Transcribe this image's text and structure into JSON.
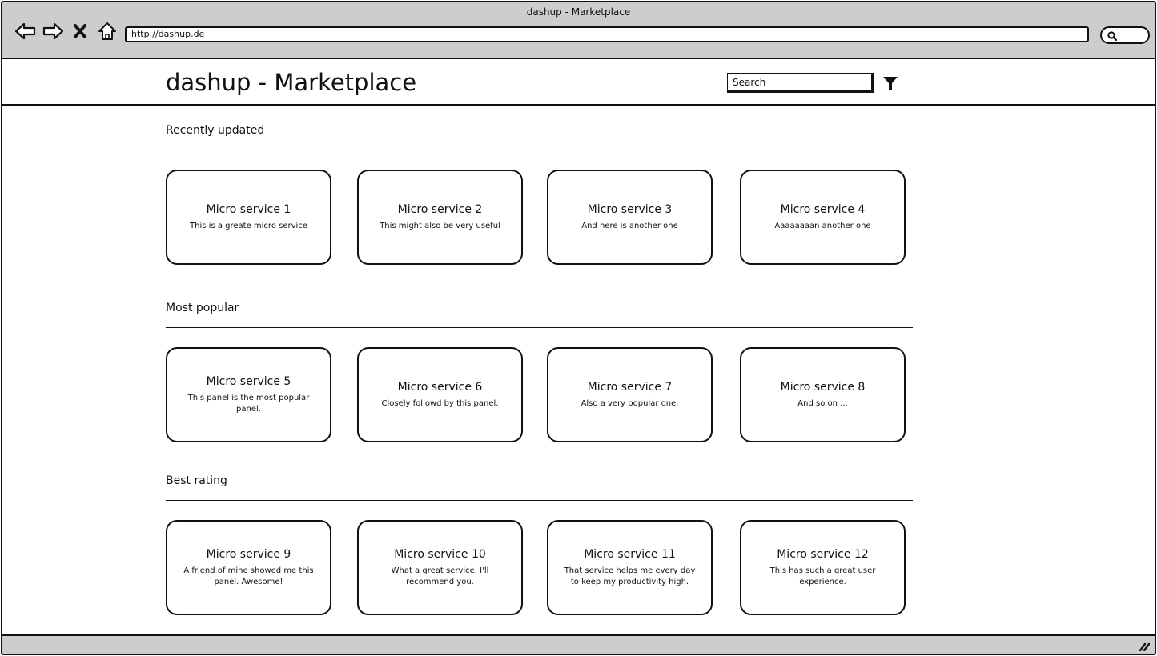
{
  "window": {
    "title": "dashup - Marketplace",
    "url": "http://dashup.de"
  },
  "header": {
    "title": "dashup - Marketplace",
    "search_placeholder": "Search"
  },
  "sections": [
    {
      "title": "Recently updated",
      "cards": [
        {
          "title": "Micro service 1",
          "description": "This is a greate micro service"
        },
        {
          "title": "Micro service 2",
          "description": "This might also be very useful"
        },
        {
          "title": "Micro service 3",
          "description": "And here is another one"
        },
        {
          "title": "Micro service 4",
          "description": "Aaaaaaaan another one"
        }
      ]
    },
    {
      "title": "Most popular",
      "cards": [
        {
          "title": "Micro service 5",
          "description": "This panel is the most popular panel."
        },
        {
          "title": "Micro service 6",
          "description": "Closely followd by this panel."
        },
        {
          "title": "Micro service 7",
          "description": "Also a very popular one."
        },
        {
          "title": "Micro service 8",
          "description": "And so on ..."
        }
      ]
    },
    {
      "title": "Best rating",
      "cards": [
        {
          "title": "Micro service 9",
          "description": "A friend of mine showed me this panel. Awesome!"
        },
        {
          "title": "Micro service 10",
          "description": "What a great service. I'll recommend you."
        },
        {
          "title": "Micro service 11",
          "description": "That service helps me every day to keep my productivity high."
        },
        {
          "title": "Micro service 12",
          "description": "This has such a great user experience."
        }
      ]
    }
  ],
  "icons": {
    "back": "back-arrow-icon",
    "forward": "forward-arrow-icon",
    "stop": "close-icon",
    "home": "home-icon",
    "browser_search": "search-icon",
    "filter": "filter-icon",
    "resize": "resize-grip-icon"
  }
}
